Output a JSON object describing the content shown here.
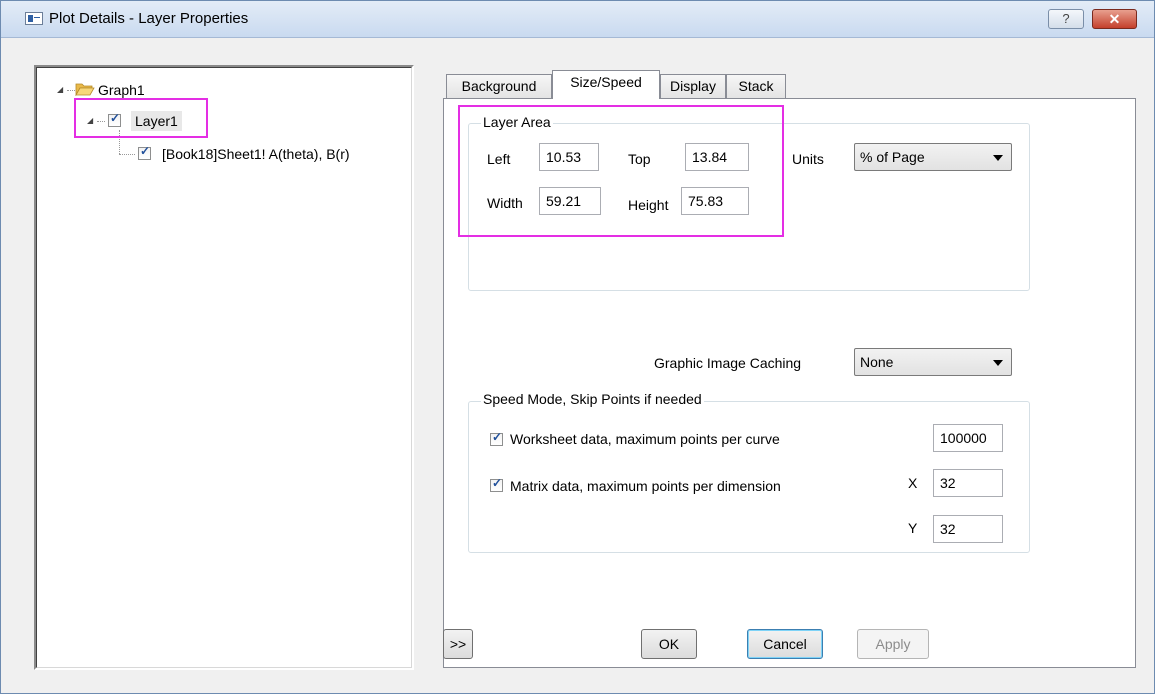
{
  "window": {
    "title": "Plot Details - Layer Properties",
    "help_label": "?",
    "close_label": "✕"
  },
  "tree": {
    "root": "Graph1",
    "layer": "Layer1",
    "plot": "[Book18]Sheet1! A(theta), B(r)"
  },
  "tabs": [
    "Background",
    "Size/Speed",
    "Display",
    "Stack"
  ],
  "active_tab": "Size/Speed",
  "layer_area": {
    "title": "Layer Area",
    "left_label": "Left",
    "left_value": "10.53",
    "top_label": "Top",
    "top_value": "13.84",
    "width_label": "Width",
    "width_value": "59.21",
    "height_label": "Height",
    "height_value": "75.83",
    "units_label": "Units",
    "units_value": "% of Page"
  },
  "caching": {
    "label": "Graphic Image Caching",
    "value": "None"
  },
  "speed": {
    "title": "Speed Mode, Skip Points if needed",
    "worksheet_label": "Worksheet data, maximum points per curve",
    "worksheet_value": "100000",
    "matrix_label": "Matrix data, maximum points per dimension",
    "x_label": "X",
    "x_value": "32",
    "y_label": "Y",
    "y_value": "32"
  },
  "buttons": {
    "expand": ">>",
    "ok": "OK",
    "cancel": "Cancel",
    "apply": "Apply"
  },
  "colors": {
    "highlight": "#e42ee4"
  }
}
